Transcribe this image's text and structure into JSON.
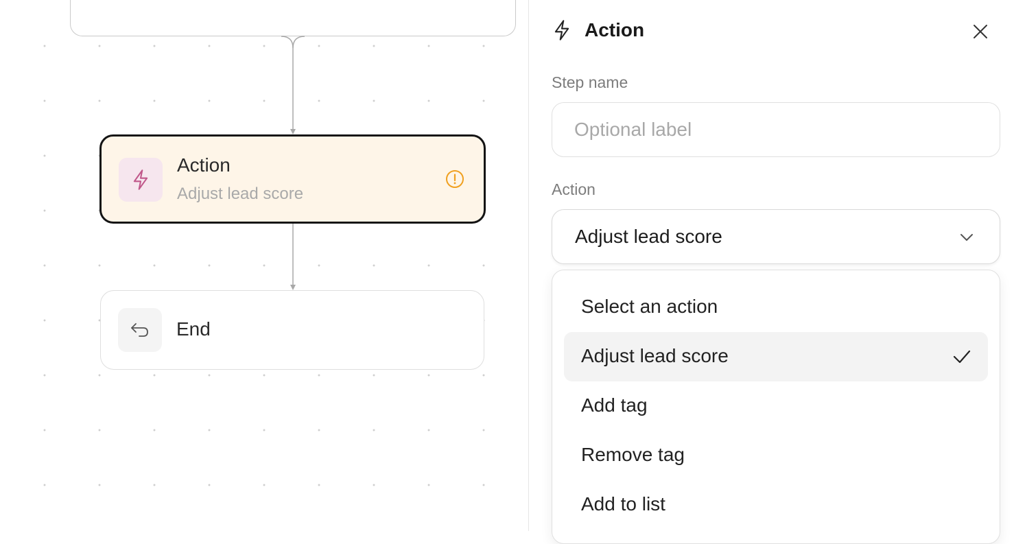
{
  "flow": {
    "action_node": {
      "title": "Action",
      "subtitle": "Adjust lead score",
      "icon": "lightning-icon",
      "status_icon": "warning-icon"
    },
    "end_node": {
      "title": "End",
      "icon": "return-arrow-icon"
    }
  },
  "panel": {
    "title": "Action",
    "title_icon": "lightning-icon",
    "close_icon": "close-icon",
    "step_name": {
      "label": "Step name",
      "placeholder": "Optional label",
      "value": ""
    },
    "action": {
      "label": "Action",
      "selected": "Adjust lead score",
      "options": [
        "Select an action",
        "Adjust lead score",
        "Add tag",
        "Remove tag",
        "Add to list"
      ]
    }
  },
  "colors": {
    "action_node_bg": "#fef5e8",
    "action_icon_bg": "#f6e6ee",
    "action_icon": "#c0578a",
    "warning": "#f0a020"
  }
}
